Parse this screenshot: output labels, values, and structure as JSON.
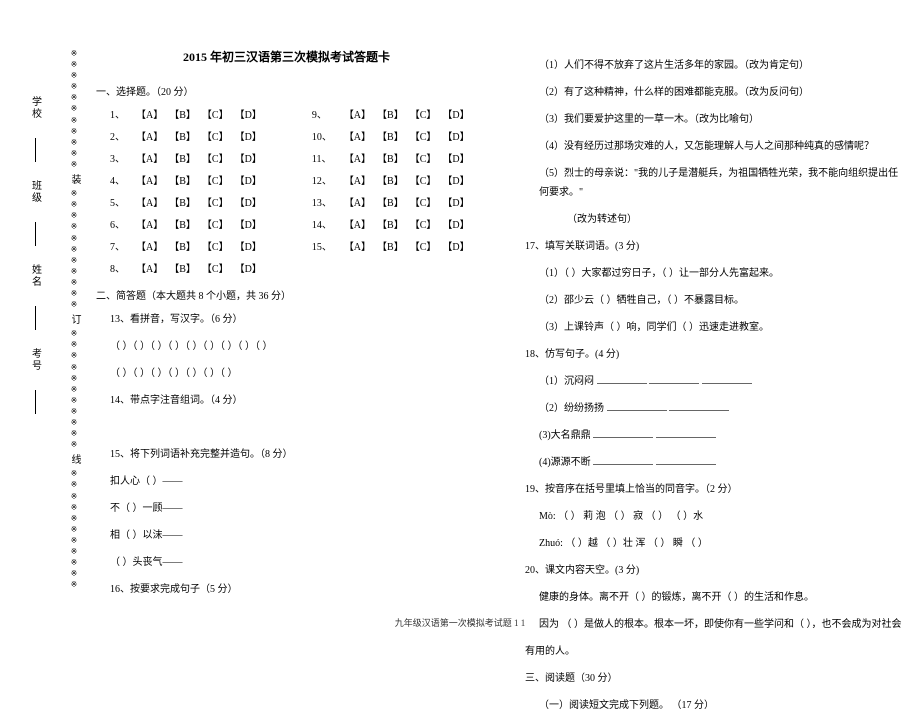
{
  "margin": {
    "labels": [
      "学校",
      "班级",
      "姓名",
      "考号"
    ],
    "dot_labels": [
      "装",
      "订",
      "线"
    ]
  },
  "title": "2015 年初三汉语第三次模拟考试答题卡",
  "section1": {
    "heading": "一、选择题。（20 分）",
    "options": [
      "【A】",
      "【B】",
      "【C】",
      "【D】"
    ]
  },
  "section2": {
    "heading": "二、简答题（本大题共 8 个小题，共 36 分）",
    "q13": "13、看拼音，写汉字。（6 分）",
    "q14": "14、带点字注音组词。（4 分）",
    "q15": "15、将下列词语补充完整并造句。（8 分）",
    "q15_items": [
      "扣人心（    ）——",
      "不（    ）一顾——",
      "相（    ）以沫——",
      "（    ）头丧气——"
    ],
    "q16": "16、按要求完成句子（5 分）",
    "q16_items": [
      "（1）人们不得不放弃了这片生活多年的家园。（改为肯定句）",
      "（2）有了这种精神，什么样的困难都能克服。（改为反问句）",
      "（3）我们要爱护这里的一草一木。（改为比喻句）",
      "（4）没有经历过那场灾难的人，又怎能理解人与人之间那种纯真的感情呢？",
      "（5）烈士的母亲说：\"我的儿子是潜艇兵，为祖国牺牲光荣，我不能向组织提出任何要求。\""
    ],
    "q16_tail": "（改为转述句）",
    "q17": "17、填写关联词语。(3 分)",
    "q17_items": [
      "（1）（          ）大家都过穷日子，（          ）让一部分人先富起来。",
      "（2）邵少云（          ）牺牲自己，（          ）不暴露目标。",
      "（3）上课铃声（          ）响，同学们（          ）迅速走进教室。"
    ],
    "q18": "18、仿写句子。(4 分)",
    "q18_items": [
      "（1）沉闷闷",
      "（2）纷纷扬扬",
      "(3)大名鼎鼎",
      "(4)源源不断"
    ],
    "q19": "19、按音序在括号里填上恰当的同音字。（2 分）",
    "q19_l1": "Mò:      （    ）     莉  泡   （    ）    寂  （    ）    （    ）水",
    "q19_l2": "Zhuó:    （    ）越    （    ）壮     浑   （    ）  瞬  （    ）",
    "q20": "20、课文内容天空。(3 分)",
    "q20_l1": "健康的身体。离不开（            ）的锻炼，离不开（            ）的生活和作息。",
    "q20_l2": "因为 （          ）是做人的根本。根本一坏，即使你有一些学问和（          ），也不会成为对社会",
    "q20_l3": "有用的人。"
  },
  "section3": {
    "heading": "三、阅读题（30 分）",
    "sub": "（一）阅读短文完成下列题。 （17 分）"
  },
  "footer": "九年级汉语第一次模拟考试题 1      1"
}
